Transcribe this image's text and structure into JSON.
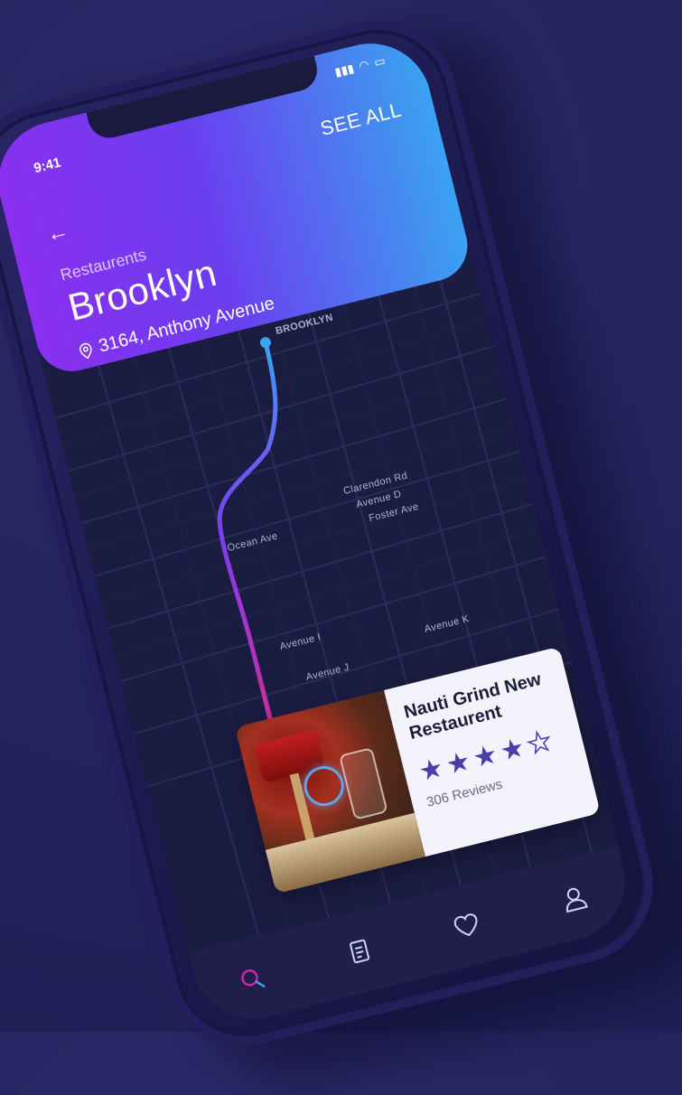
{
  "status": {
    "time": "9:41"
  },
  "header": {
    "see_all_label": "SEE ALL",
    "back_label": "←",
    "category": "Restaurents",
    "city": "Brooklyn",
    "address": "3164, Anthony Avenue"
  },
  "map": {
    "labels": [
      "BROOKLYN",
      "Ocean Ave",
      "Clarendon Rd",
      "Avenue D",
      "Foster Ave",
      "Avenue I",
      "Avenue J",
      "Avenue K"
    ],
    "route_colors": [
      "#3da2f3",
      "#7a3ff0",
      "#d12c9d"
    ]
  },
  "restaurant_card": {
    "name": "Nauti Grind New Restaurent",
    "rating": 4,
    "rating_max": 5,
    "reviews": "306 Reviews"
  },
  "bottom_nav": {
    "items": [
      {
        "name": "search",
        "icon": "search-icon",
        "active": true
      },
      {
        "name": "menu",
        "icon": "receipt-icon",
        "active": false
      },
      {
        "name": "favorites",
        "icon": "heart-icon",
        "active": false
      },
      {
        "name": "profile",
        "icon": "user-icon",
        "active": false
      }
    ]
  },
  "colors": {
    "header_gradient_start": "#8b2ff0",
    "header_gradient_end": "#3aa2f0",
    "accent": "#d024a6",
    "star": "#4a3fa9",
    "background": "#25245f"
  }
}
